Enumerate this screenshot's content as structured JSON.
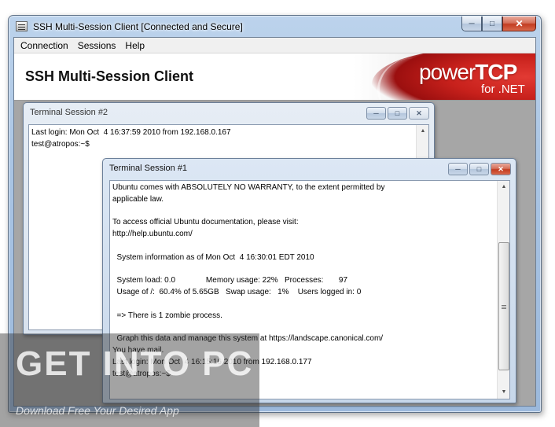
{
  "window": {
    "title": "SSH Multi-Session Client [Connected and Secure]"
  },
  "menu": [
    "Connection",
    "Sessions",
    "Help"
  ],
  "banner": {
    "title": "SSH Multi-Session Client",
    "logo_main": "power",
    "logo_bold": "TCP",
    "logo_sub": "for .NET"
  },
  "session2": {
    "title": "Terminal Session #2",
    "lines": [
      "Last login: Mon Oct  4 16:37:59 2010 from 192.168.0.167",
      "test@atropos:~$"
    ]
  },
  "session1": {
    "title": "Terminal Session #1",
    "lines": [
      "Ubuntu comes with ABSOLUTELY NO WARRANTY, to the extent permitted by",
      "applicable law.",
      "",
      "To access official Ubuntu documentation, please visit:",
      "http://help.ubuntu.com/",
      "",
      "  System information as of Mon Oct  4 16:30:01 EDT 2010",
      "",
      "  System load: 0.0              Memory usage: 22%   Processes:       97",
      "  Usage of /:  60.4% of 5.65GB   Swap usage:   1%    Users logged in: 0",
      "",
      "  => There is 1 zombie process.",
      "",
      "  Graph this data and manage this system at https://landscape.canonical.com/",
      "You have mail.",
      "Last login: Mon Oct  4 16:15:16 2010 from 192.168.0.177",
      "test@atropos:~$"
    ]
  },
  "watermark": {
    "main": "GET INTO PC",
    "sub": "Download Free Your Desired App"
  }
}
